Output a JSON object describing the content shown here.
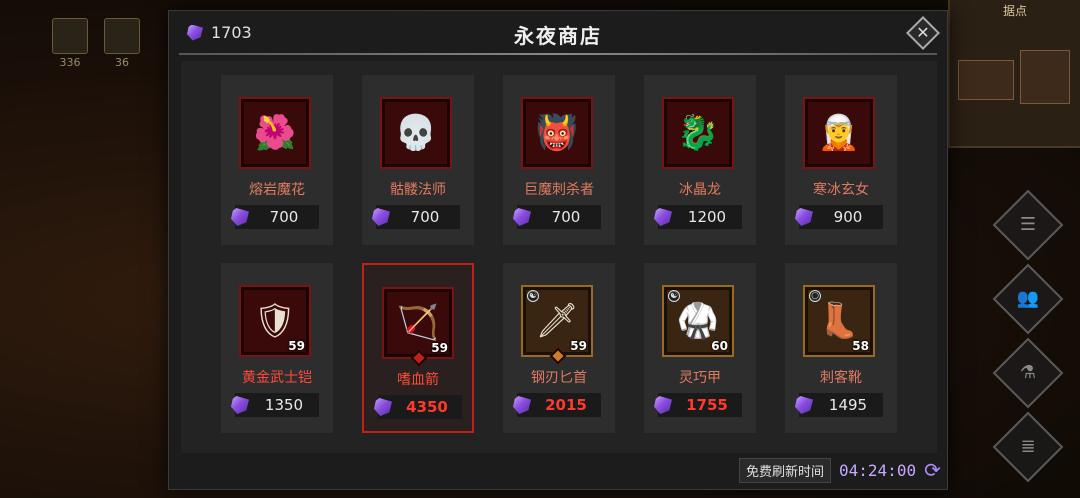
{
  "hud": {
    "slot_counts": [
      "336",
      "36"
    ]
  },
  "minimap": {
    "title": "据点"
  },
  "side_buttons": [
    {
      "icon": "scroll-icon",
      "glyph": "☰"
    },
    {
      "icon": "team-icon",
      "glyph": "👥"
    },
    {
      "icon": "potion-icon",
      "glyph": "⚗"
    },
    {
      "icon": "list-icon",
      "glyph": "≣"
    }
  ],
  "shop": {
    "title": "永夜商店",
    "currency": "1703",
    "close_glyph": "✕",
    "refresh_label": "免费刷新时间",
    "refresh_time": "04:24:00",
    "refresh_glyph": "⟳",
    "items": [
      {
        "name": "熔岩魔花",
        "price": "700",
        "icon": "🌺"
      },
      {
        "name": "骷髅法师",
        "price": "700",
        "icon": "💀"
      },
      {
        "name": "巨魔刺杀者",
        "price": "700",
        "icon": "👹"
      },
      {
        "name": "冰晶龙",
        "price": "1200",
        "icon": "🐉"
      },
      {
        "name": "寒冰玄女",
        "price": "900",
        "icon": "🧝"
      },
      {
        "name": "黄金武士铠",
        "price": "1350",
        "level": "59",
        "icon": "🛡"
      },
      {
        "name": "嗜血箭",
        "price": "4350",
        "level": "59",
        "icon": "🏹"
      },
      {
        "name": "钢刃匕首",
        "price": "2015",
        "level": "59",
        "icon": "🗡",
        "tag": "☯"
      },
      {
        "name": "灵巧甲",
        "price": "1755",
        "level": "60",
        "icon": "🥋",
        "tag": "☯"
      },
      {
        "name": "刺客靴",
        "price": "1495",
        "level": "58",
        "icon": "👢",
        "tag": "○"
      }
    ]
  }
}
